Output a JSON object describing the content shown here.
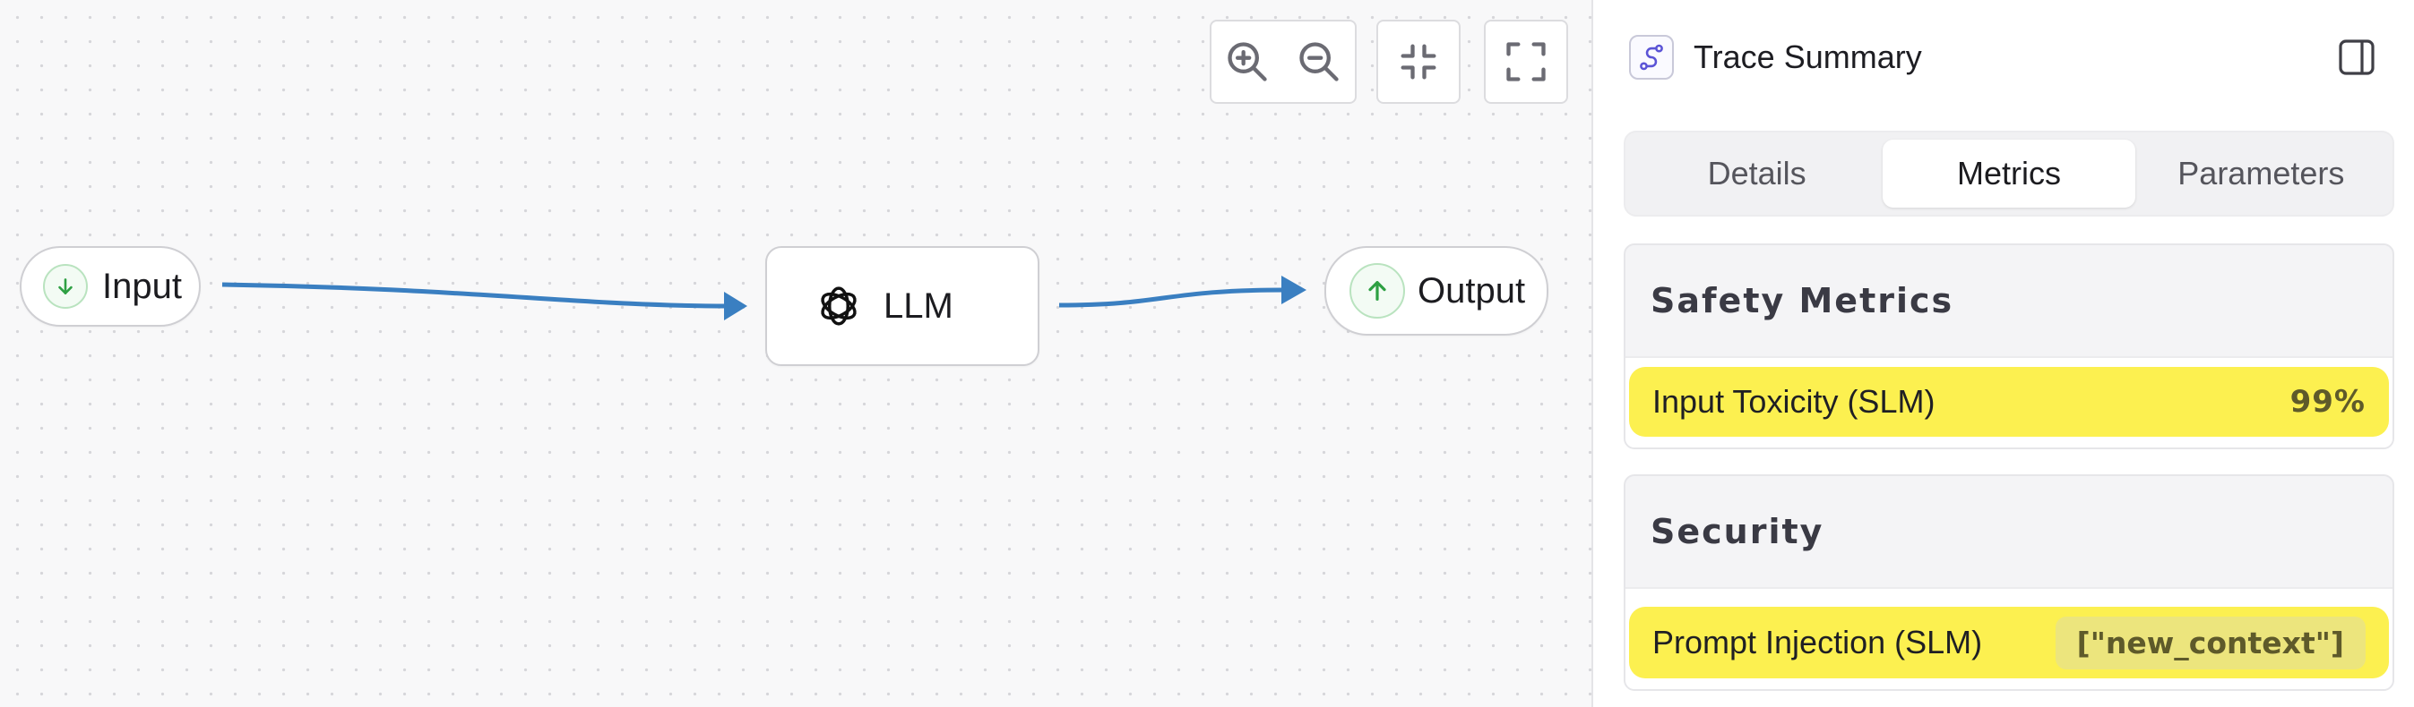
{
  "canvas": {
    "controls": {
      "zoom_in": "zoom-in-icon",
      "zoom_out": "zoom-out-icon",
      "fit_view": "minimize-icon",
      "fullscreen": "fullscreen-icon"
    },
    "nodes": {
      "input": {
        "label": "Input",
        "icon": "arrow-down-icon"
      },
      "llm": {
        "label": "LLM",
        "icon": "openai-logo-icon"
      },
      "output": {
        "label": "Output",
        "icon": "arrow-up-icon"
      }
    },
    "colors": {
      "edge": "#3a7fc1",
      "node_icon_green": "#2ea043"
    }
  },
  "panel": {
    "title": "Trace Summary",
    "tabs": [
      {
        "label": "Details",
        "active": false
      },
      {
        "label": "Metrics",
        "active": true
      },
      {
        "label": "Parameters",
        "active": false
      }
    ],
    "sections": [
      {
        "title": "Safety Metrics",
        "rows": [
          {
            "label": "Input Toxicity (SLM)",
            "value": "99%"
          }
        ]
      },
      {
        "title": "Security",
        "rows": [
          {
            "label": "Prompt Injection (SLM)",
            "value": "[\"new_context\"]"
          }
        ]
      }
    ],
    "colors": {
      "highlight": "#fcf050",
      "accent_icon": "#5b54d6"
    }
  }
}
